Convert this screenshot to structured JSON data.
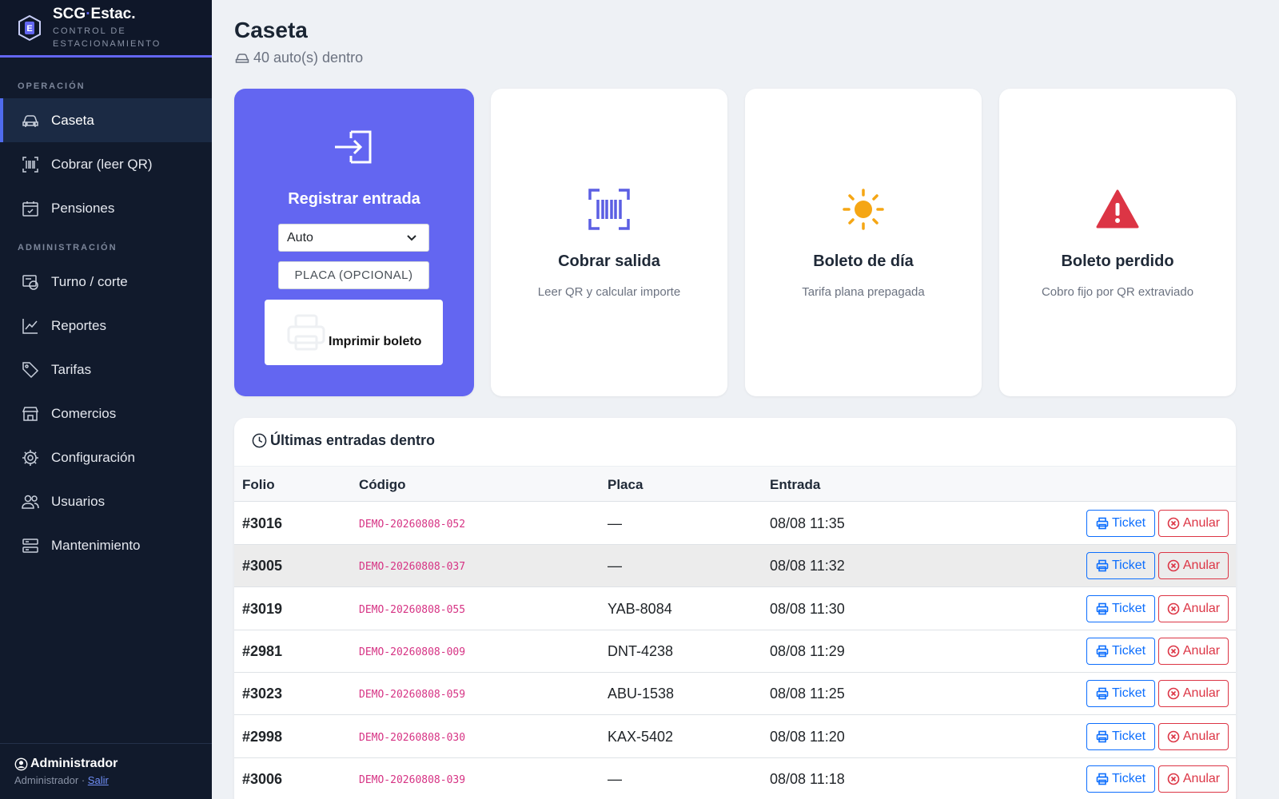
{
  "brand": {
    "title_part1": "SCG",
    "title_dot": "·",
    "title_part2": "Estac.",
    "subtitle_line1": "CONTROL DE",
    "subtitle_line2": "ESTACIONAMIENTO",
    "logo_letter": "E"
  },
  "sidebar": {
    "section_operacion": "OPERACIÓN",
    "section_admin": "ADMINISTRACIÓN",
    "items": [
      {
        "label": "Caseta",
        "icon": "car-icon"
      },
      {
        "label": "Cobrar (leer QR)",
        "icon": "barcode-scan-icon"
      },
      {
        "label": "Pensiones",
        "icon": "calendar-check-icon"
      },
      {
        "label": "Turno / corte",
        "icon": "cash-register-icon"
      },
      {
        "label": "Reportes",
        "icon": "chart-line-icon"
      },
      {
        "label": "Tarifas",
        "icon": "tag-icon"
      },
      {
        "label": "Comercios",
        "icon": "shop-icon"
      },
      {
        "label": "Configuración",
        "icon": "gear-icon"
      },
      {
        "label": "Usuarios",
        "icon": "people-icon"
      },
      {
        "label": "Mantenimiento",
        "icon": "server-icon"
      }
    ],
    "active": "Caseta",
    "user": {
      "name": "Administrador",
      "role": "Administrador",
      "separator": "·",
      "logout": "Salir"
    }
  },
  "main": {
    "title": "Caseta",
    "subtitle": "40 auto(s) dentro",
    "entry_card": {
      "title": "Registrar entrada",
      "vehicle_selected": "Auto",
      "plate_placeholder": "PLACA (OPCIONAL)",
      "print_label": "Imprimir boleto"
    },
    "cards": [
      {
        "title": "Cobrar salida",
        "desc": "Leer QR y calcular importe",
        "icon": "barcode-scan-icon"
      },
      {
        "title": "Boleto de día",
        "desc": "Tarifa plana prepagada",
        "icon": "sun-icon"
      },
      {
        "title": "Boleto perdido",
        "desc": "Cobro fijo por QR extraviado",
        "icon": "warning-triangle-icon"
      }
    ],
    "table": {
      "title": "Últimas entradas dentro",
      "headers": [
        "Folio",
        "Código",
        "Placa",
        "Entrada"
      ],
      "ticket_label": "Ticket",
      "void_label": "Anular",
      "rows": [
        {
          "folio": "#3016",
          "code": "DEMO-20260808-052",
          "plate": "—",
          "entry": "08/08 11:35"
        },
        {
          "folio": "#3005",
          "code": "DEMO-20260808-037",
          "plate": "—",
          "entry": "08/08 11:32"
        },
        {
          "folio": "#3019",
          "code": "DEMO-20260808-055",
          "plate": "YAB-8084",
          "entry": "08/08 11:30"
        },
        {
          "folio": "#2981",
          "code": "DEMO-20260808-009",
          "plate": "DNT-4238",
          "entry": "08/08 11:29"
        },
        {
          "folio": "#3023",
          "code": "DEMO-20260808-059",
          "plate": "ABU-1538",
          "entry": "08/08 11:25"
        },
        {
          "folio": "#2998",
          "code": "DEMO-20260808-030",
          "plate": "KAX-5402",
          "entry": "08/08 11:20"
        },
        {
          "folio": "#3006",
          "code": "DEMO-20260808-039",
          "plate": "—",
          "entry": "08/08 11:18"
        }
      ]
    }
  },
  "colors": {
    "accent": "#6366f1",
    "sidebar_bg": "#111a2c",
    "primary": "#0d6efd",
    "danger": "#dc3545",
    "code": "#d63384",
    "sun": "#f5a614"
  }
}
